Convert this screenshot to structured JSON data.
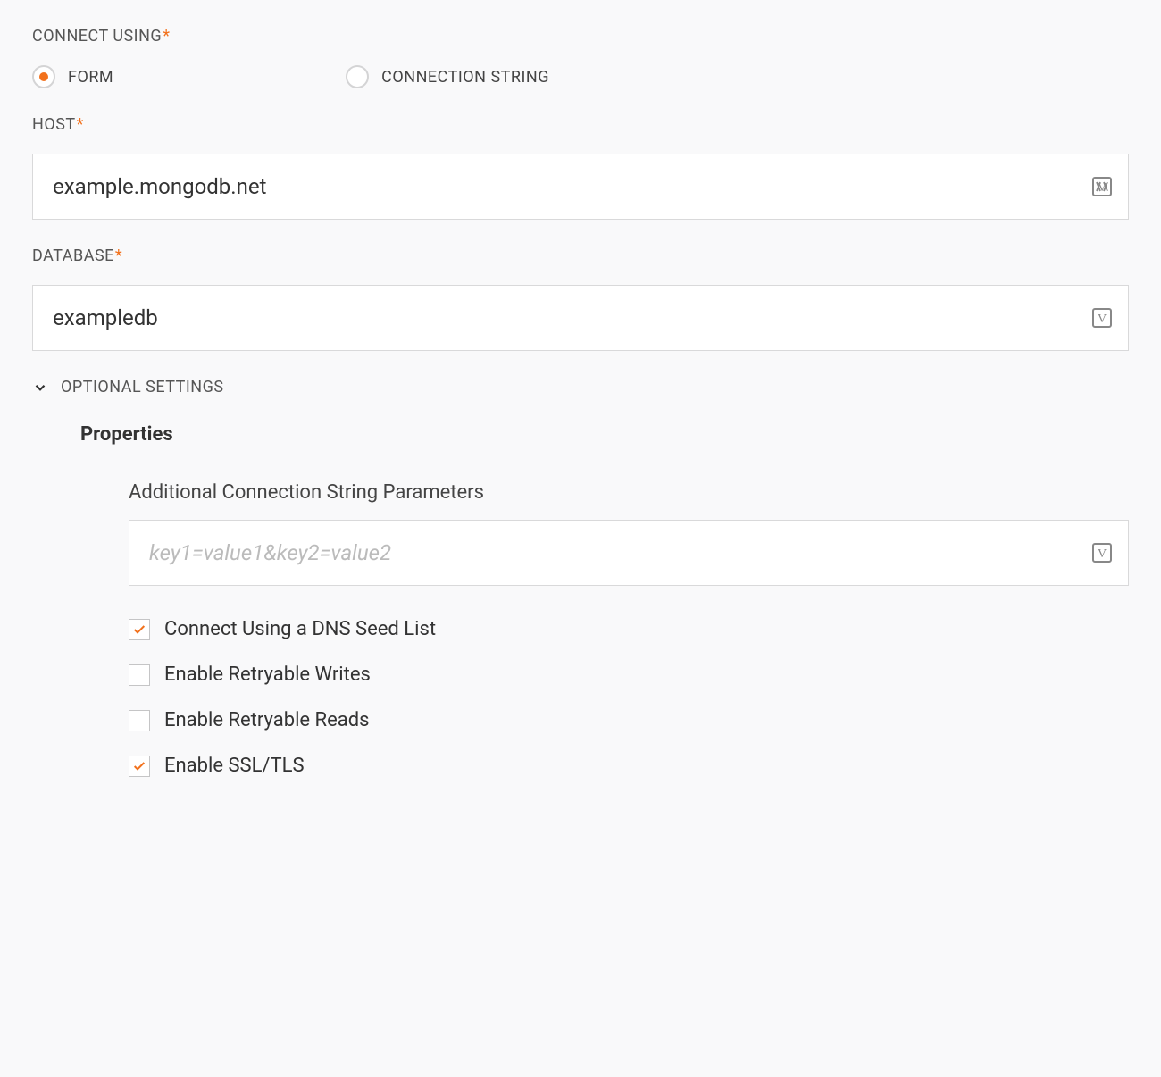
{
  "connectUsing": {
    "label": "CONNECT USING",
    "required": true,
    "options": {
      "form": {
        "label": "FORM",
        "selected": true
      },
      "connectionString": {
        "label": "CONNECTION STRING",
        "selected": false
      }
    }
  },
  "host": {
    "label": "HOST",
    "required": true,
    "value": "example.mongodb.net"
  },
  "database": {
    "label": "DATABASE",
    "required": true,
    "value": "exampledb"
  },
  "optionalSettings": {
    "label": "OPTIONAL SETTINGS",
    "expanded": true
  },
  "properties": {
    "heading": "Properties",
    "additionalParams": {
      "label": "Additional Connection String Parameters",
      "placeholder": "key1=value1&key2=value2",
      "value": ""
    },
    "checkboxes": {
      "dnsSeedList": {
        "label": "Connect Using a DNS Seed List",
        "checked": true
      },
      "retryableWrites": {
        "label": "Enable Retryable Writes",
        "checked": false
      },
      "retryableReads": {
        "label": "Enable Retryable Reads",
        "checked": false
      },
      "sslTls": {
        "label": "Enable SSL/TLS",
        "checked": true
      }
    }
  }
}
